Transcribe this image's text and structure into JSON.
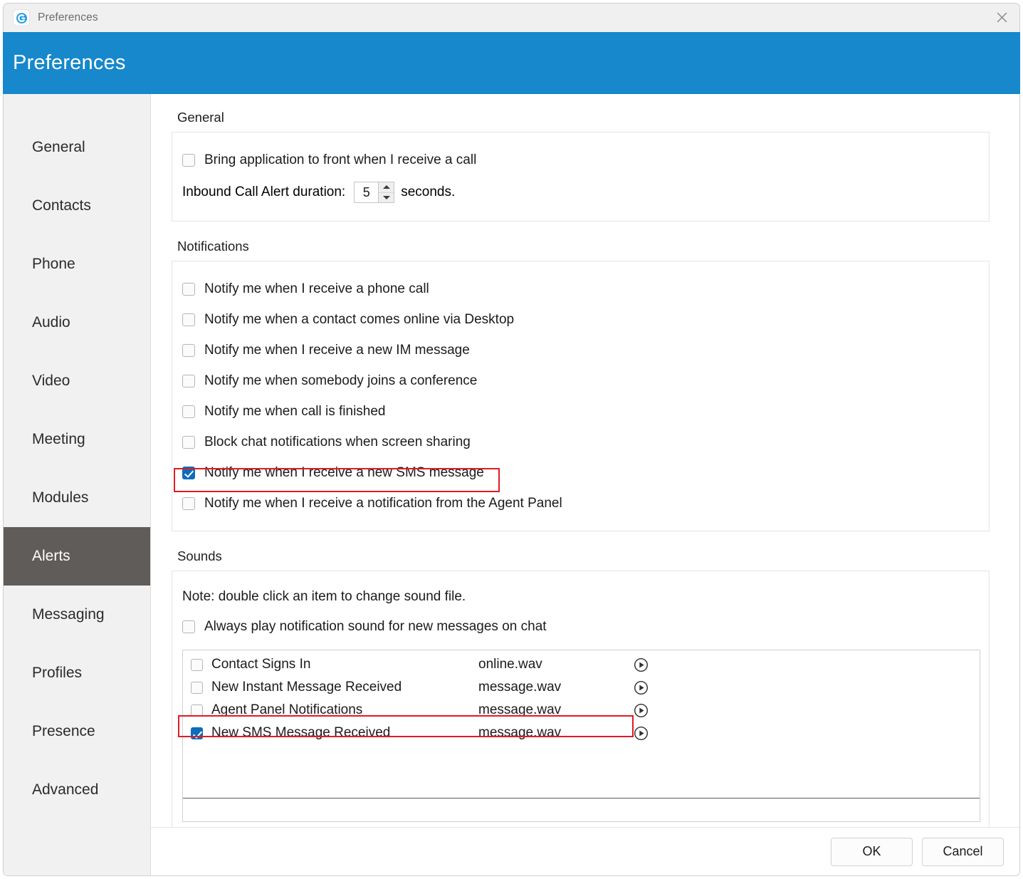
{
  "window": {
    "titlebar_text": "Preferences",
    "app_icon": "app-logo-icon",
    "close_icon": "close-icon",
    "header_title": "Preferences",
    "accent_color": "#1688cb",
    "selected_nav_color": "#5f5c59",
    "checkbox_checked_color": "#0d6cbc",
    "highlight_color": "#e01b24"
  },
  "sidebar": {
    "items": [
      {
        "label": "General",
        "selected": false
      },
      {
        "label": "Contacts",
        "selected": false
      },
      {
        "label": "Phone",
        "selected": false
      },
      {
        "label": "Audio",
        "selected": false
      },
      {
        "label": "Video",
        "selected": false
      },
      {
        "label": "Meeting",
        "selected": false
      },
      {
        "label": "Modules",
        "selected": false
      },
      {
        "label": "Alerts",
        "selected": true
      },
      {
        "label": "Messaging",
        "selected": false
      },
      {
        "label": "Profiles",
        "selected": false
      },
      {
        "label": "Presence",
        "selected": false
      },
      {
        "label": "Advanced",
        "selected": false
      }
    ]
  },
  "general": {
    "section_label": "General",
    "bring_to_front_label": "Bring application to front when I receive a call",
    "bring_to_front_checked": false,
    "duration_label": "Inbound Call Alert duration:",
    "duration_value": "5",
    "duration_suffix": "seconds."
  },
  "notifications": {
    "section_label": "Notifications",
    "items": [
      {
        "label": "Notify me when I receive a phone call",
        "checked": false,
        "highlighted": false
      },
      {
        "label": "Notify me when a contact comes online via Desktop",
        "checked": false,
        "highlighted": false
      },
      {
        "label": "Notify me when I receive a new IM message",
        "checked": false,
        "highlighted": false
      },
      {
        "label": "Notify me when somebody joins a conference",
        "checked": false,
        "highlighted": false
      },
      {
        "label": "Notify me when call is finished",
        "checked": false,
        "highlighted": false
      },
      {
        "label": "Block chat notifications when screen sharing",
        "checked": false,
        "highlighted": false
      },
      {
        "label": "Notify me when I receive a new SMS message",
        "checked": true,
        "highlighted": true
      },
      {
        "label": "Notify me when I receive a notification from the Agent Panel",
        "checked": false,
        "highlighted": false
      }
    ]
  },
  "sounds": {
    "section_label": "Sounds",
    "note": "Note: double click an item to change sound file.",
    "always_play_label": "Always play notification sound for new messages on chat",
    "always_play_checked": false,
    "play_icon": "play-circle-icon",
    "rows": [
      {
        "name": "Contact Signs In",
        "file": "online.wav",
        "checked": false,
        "highlighted": false
      },
      {
        "name": "New Instant Message Received",
        "file": "message.wav",
        "checked": false,
        "highlighted": false
      },
      {
        "name": "Agent Panel Notifications",
        "file": "message.wav",
        "checked": false,
        "highlighted": false
      },
      {
        "name": "New SMS Message Received",
        "file": "message.wav",
        "checked": true,
        "highlighted": true
      }
    ]
  },
  "footer": {
    "ok_label": "OK",
    "cancel_label": "Cancel"
  }
}
